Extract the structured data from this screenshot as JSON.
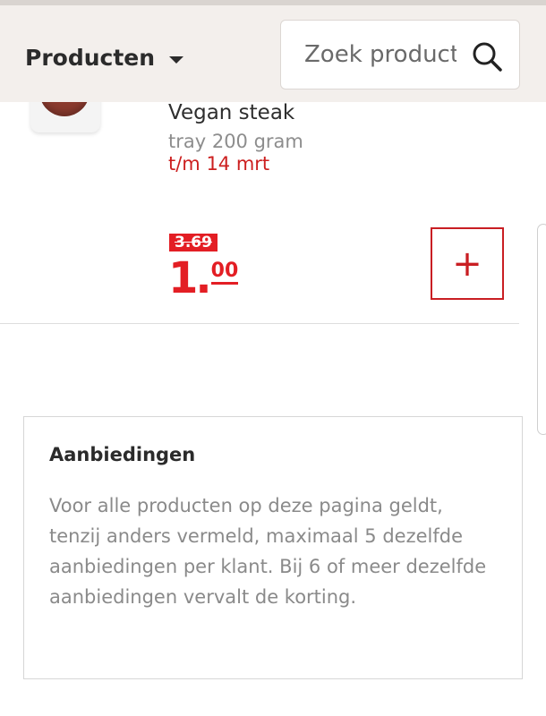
{
  "header": {
    "category_label": "Producten",
    "search_placeholder": "Zoek product"
  },
  "product": {
    "name": "Vegan steak",
    "size": "tray 200 gram",
    "valid_until": "t/m 14 mrt",
    "old_price": "3.69",
    "new_price_euros": "1.",
    "new_price_cents": "00",
    "add_button": "+"
  },
  "offers": {
    "title": "Aanbiedingen",
    "text": "Voor alle producten op deze pagina geldt, tenzij anders vermeld, maximaal 5 dezelfde aanbiedingen per klant. Bij 6 of meer dezelfde aanbiedingen vervalt de korting."
  },
  "colors": {
    "brand_red": "#e31e24",
    "header_bg": "#f3efec"
  },
  "icons": [
    "chevron-down-icon",
    "search-icon",
    "plus-icon"
  ]
}
